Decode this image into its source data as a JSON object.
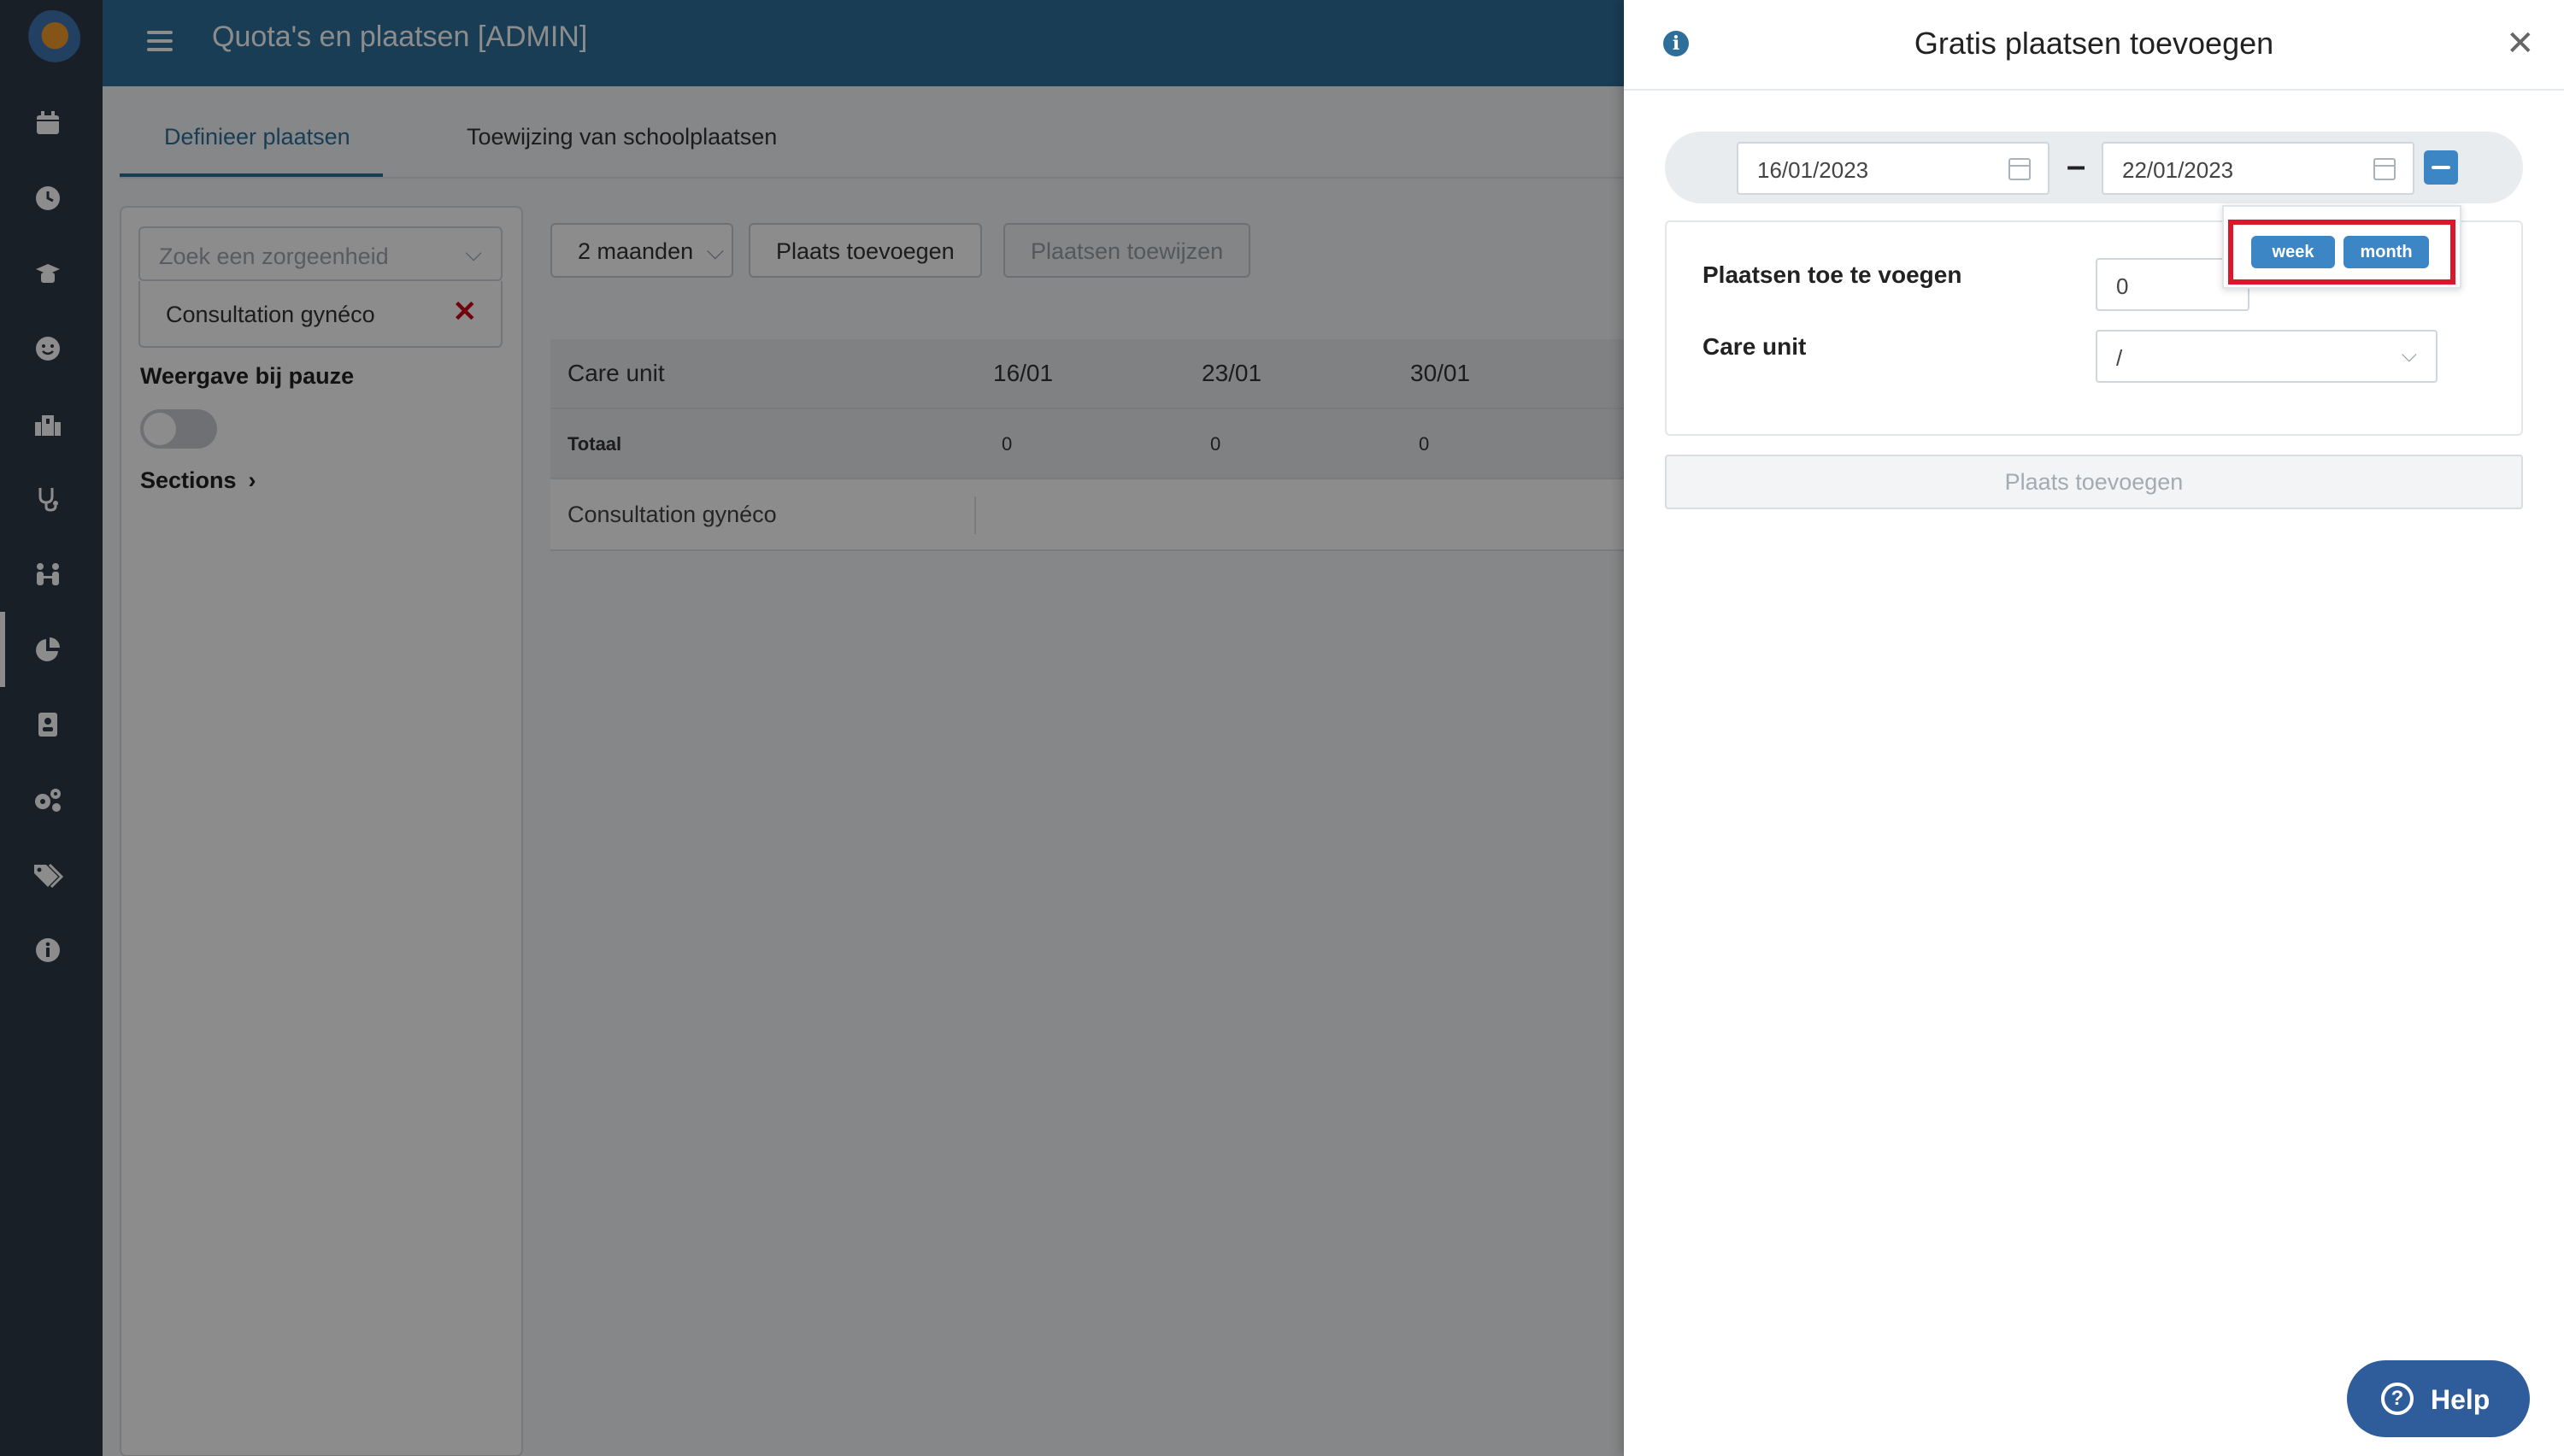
{
  "header": {
    "title": "Quota's en plaatsen [ADMIN]"
  },
  "sidebar": {
    "icons": [
      "calendar-icon",
      "clock-icon",
      "graduation-icon",
      "smiley-icon",
      "building-icon",
      "stethoscope-icon",
      "people-icon",
      "pie-chart-icon",
      "badge-icon",
      "gears-icon",
      "tags-icon",
      "info-icon"
    ]
  },
  "main": {
    "tabs": [
      {
        "label": "Definieer plaatsen"
      },
      {
        "label": "Toewijzing van schoolplaatsen"
      }
    ],
    "filter": {
      "search_placeholder": "Zoek een zorgeenheid",
      "selected_unit": "Consultation gynéco",
      "pause_label": "Weergave bij pauze",
      "sections_label": "Sections"
    },
    "toolbar": {
      "period": "2 maanden",
      "add_button": "Plaats toevoegen",
      "assign_button": "Plaatsen toewijzen"
    },
    "table": {
      "headers": [
        "Care unit",
        "16/01",
        "23/01",
        "30/01"
      ],
      "total_label": "Totaal",
      "totals": [
        "0",
        "0",
        "0"
      ],
      "rows": [
        {
          "unit": "Consultation gynéco"
        }
      ]
    }
  },
  "drawer": {
    "title": "Gratis plaatsen toevoegen",
    "start_date": "16/01/2023",
    "end_date": "22/01/2023",
    "date_separator": "–",
    "presets": [
      "week",
      "month"
    ],
    "places_label": "Plaatsen toe te voegen",
    "places_value": "0",
    "care_unit_label": "Care unit",
    "care_unit_value": "/",
    "submit_label": "Plaats toevoegen"
  },
  "help": {
    "label": "Help"
  },
  "colors": {
    "primary": "#2e6f99",
    "accent": "#3d86c6",
    "highlight": "#d9182b",
    "sidebar": "#2f3a45"
  }
}
